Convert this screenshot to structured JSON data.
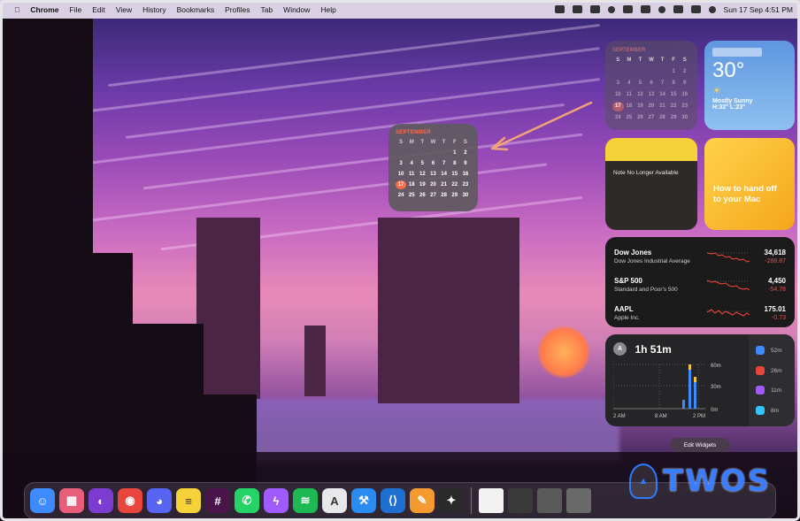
{
  "menubar": {
    "app_name": "Chrome",
    "menus": [
      "File",
      "Edit",
      "View",
      "History",
      "Bookmarks",
      "Profiles",
      "Tab",
      "Window",
      "Help"
    ],
    "clock": "Sun 17 Sep  4:51 PM"
  },
  "calendar_widget": {
    "month": "SEPTEMBER",
    "weekdays": [
      "S",
      "M",
      "T",
      "W",
      "T",
      "F",
      "S"
    ],
    "days": [
      "",
      "",
      "",
      "",
      "",
      "1",
      "2",
      "3",
      "4",
      "5",
      "6",
      "7",
      "8",
      "9",
      "10",
      "11",
      "12",
      "13",
      "14",
      "15",
      "16",
      "17",
      "18",
      "19",
      "20",
      "21",
      "22",
      "23",
      "24",
      "25",
      "26",
      "27",
      "28",
      "29",
      "30"
    ],
    "today": "17"
  },
  "faded_calendar_widget": {
    "month": "SEPTEMBER"
  },
  "weather_widget": {
    "temperature": "30°",
    "condition": "Mostly Sunny",
    "high_low": "H:32° L:23°"
  },
  "notes_widget": {
    "text": "Note No Longer Available"
  },
  "tips_widget": {
    "text": "How to hand off to your Mac"
  },
  "stocks_widget": {
    "rows": [
      {
        "symbol": "Dow Jones",
        "name": "Dow Jones Industrial Average",
        "price": "34,618",
        "change": "-288.87"
      },
      {
        "symbol": "S&P 500",
        "name": "Standard and Poor's 500",
        "price": "4,450",
        "change": "-54.78"
      },
      {
        "symbol": "AAPL",
        "name": "Apple Inc.",
        "price": "175.01",
        "change": "-0.73"
      }
    ]
  },
  "screentime_widget": {
    "avatar_initial": "A",
    "total": "1h 51m",
    "y_labels": [
      "60m",
      "30m",
      "0m"
    ],
    "x_labels": [
      "2 AM",
      "8 AM",
      "2 PM"
    ],
    "apps": [
      {
        "icon": "finder-icon",
        "duration": "52m",
        "color": "#3d8bff"
      },
      {
        "icon": "chrome-icon",
        "duration": "26m",
        "color": "#e8453c"
      },
      {
        "icon": "figma-icon",
        "duration": "11m",
        "color": "#a259ff"
      },
      {
        "icon": "screen-icon",
        "duration": "8m",
        "color": "#34c3ff"
      }
    ]
  },
  "edit_widgets_label": "Edit Widgets",
  "dock": {
    "apps": [
      {
        "name": "finder-icon",
        "glyph": "☺",
        "color": "#3d8bff"
      },
      {
        "name": "launchpad-icon",
        "glyph": "▦",
        "color": "#e85e7a"
      },
      {
        "name": "github-desktop-icon",
        "glyph": "◐",
        "color": "#7c3ccf"
      },
      {
        "name": "chrome-icon",
        "glyph": "◉",
        "color": "#e8453c"
      },
      {
        "name": "discord-icon",
        "glyph": "◕",
        "color": "#5865f2"
      },
      {
        "name": "notes-icon",
        "glyph": "≡",
        "color": "#f6d23a"
      },
      {
        "name": "slack-icon",
        "glyph": "#",
        "color": "#4a154b"
      },
      {
        "name": "whatsapp-icon",
        "glyph": "✆",
        "color": "#25d366"
      },
      {
        "name": "messenger-icon",
        "glyph": "ϟ",
        "color": "#a05bff"
      },
      {
        "name": "spotify-icon",
        "glyph": "≋",
        "color": "#1db954"
      },
      {
        "name": "ai-app-icon",
        "glyph": "A",
        "color": "#e8e8ea"
      },
      {
        "name": "xcode-icon",
        "glyph": "⚒",
        "color": "#2a8cf0"
      },
      {
        "name": "vscode-icon",
        "glyph": "⟨⟩",
        "color": "#1f6fd1"
      },
      {
        "name": "pages-icon",
        "glyph": "✎",
        "color": "#f59a30"
      },
      {
        "name": "figma-icon",
        "glyph": "✦",
        "color": "#2a2a2a"
      }
    ],
    "recent": [
      {
        "name": "document-icon",
        "color": "#f2f2f2"
      },
      {
        "name": "window-thumbnail-icon",
        "color": "#3a3a3a"
      },
      {
        "name": "window-thumbnail-icon",
        "color": "#5a5a5a"
      },
      {
        "name": "window-thumbnail-icon",
        "color": "#6a6a6a"
      }
    ]
  },
  "watermark": {
    "text": "TWOS"
  }
}
